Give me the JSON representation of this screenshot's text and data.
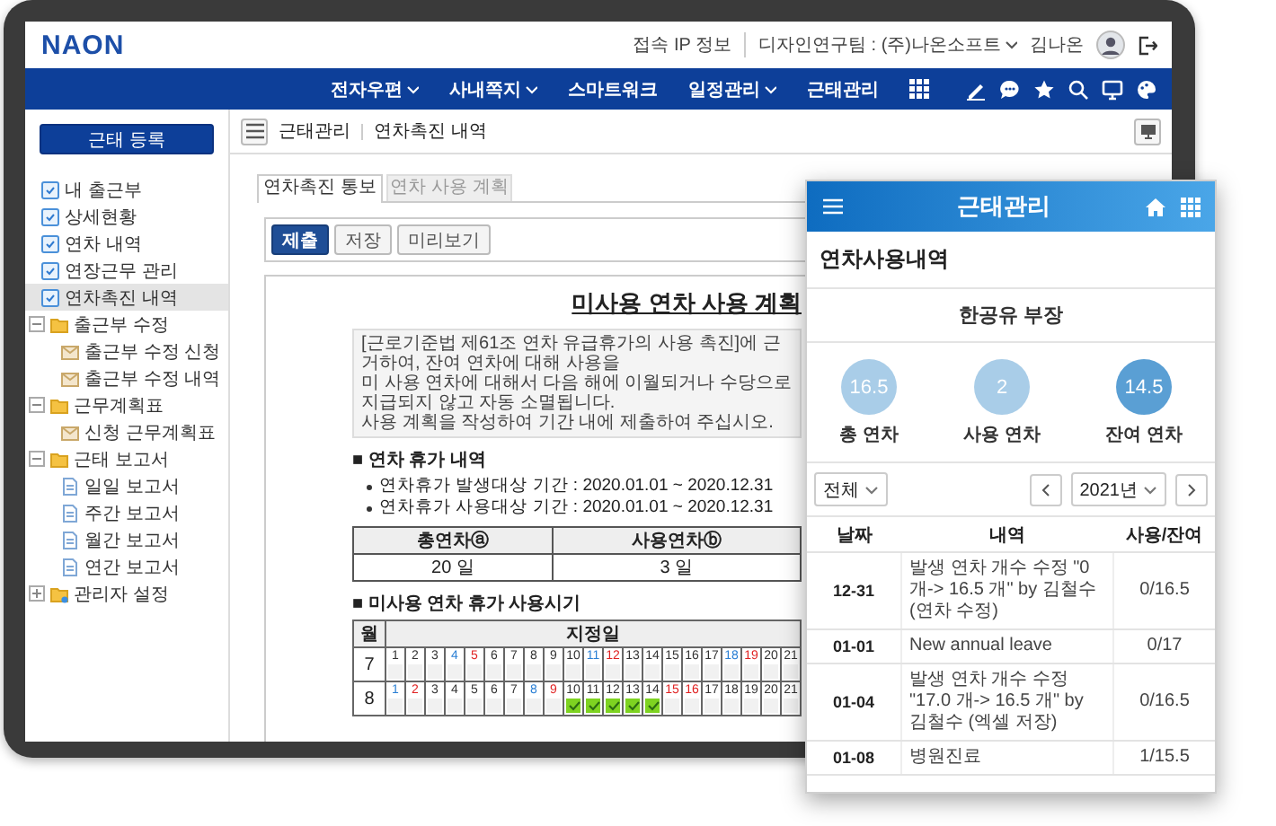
{
  "header": {
    "logo": "NAON",
    "ip_info": "접속 IP 정보",
    "team": "디자인연구팀 : (주)나온소프트",
    "team_dropdown": true,
    "user": "김나온"
  },
  "nav": {
    "items": [
      {
        "label": "전자우편",
        "dropdown": true
      },
      {
        "label": "사내쪽지",
        "dropdown": true
      },
      {
        "label": "스마트워크",
        "dropdown": false
      },
      {
        "label": "일정관리",
        "dropdown": true
      },
      {
        "label": "근태관리",
        "dropdown": false
      }
    ]
  },
  "sidebar": {
    "button": "근태 등록",
    "items": [
      {
        "label": "내 출근부",
        "kind": "page",
        "selected": false
      },
      {
        "label": "상세현황",
        "kind": "page",
        "selected": false
      },
      {
        "label": "연차 내역",
        "kind": "page",
        "selected": false
      },
      {
        "label": "연장근무 관리",
        "kind": "page",
        "selected": false
      },
      {
        "label": "연차촉진 내역",
        "kind": "page",
        "selected": true
      },
      {
        "label": "출근부 수정",
        "kind": "folder",
        "selected": false,
        "expanded": true,
        "children": [
          {
            "label": "출근부 수정 신청",
            "kind": "form",
            "selected": false
          },
          {
            "label": "출근부 수정 내역",
            "kind": "form",
            "selected": false
          }
        ]
      },
      {
        "label": "근무계획표",
        "kind": "folder",
        "selected": false,
        "expanded": true,
        "children": [
          {
            "label": "신청 근무계획표",
            "kind": "form",
            "selected": false
          }
        ]
      },
      {
        "label": "근태 보고서",
        "kind": "folder",
        "selected": false,
        "expanded": true,
        "children": [
          {
            "label": "일일 보고서",
            "kind": "report",
            "selected": false
          },
          {
            "label": "주간 보고서",
            "kind": "report",
            "selected": false
          },
          {
            "label": "월간 보고서",
            "kind": "report",
            "selected": false
          },
          {
            "label": "연간 보고서",
            "kind": "report",
            "selected": false
          }
        ]
      },
      {
        "label": "관리자 설정",
        "kind": "admin",
        "selected": false,
        "expanded": false
      }
    ]
  },
  "main": {
    "breadcrumb": [
      "근태관리",
      "연차촉진 내역"
    ],
    "tabs": [
      {
        "label": "연차촉진 통보",
        "selected": true
      },
      {
        "label": "연차 사용 계획",
        "selected": false
      }
    ],
    "toolbar": [
      {
        "label": "제출",
        "primary": true
      },
      {
        "label": "저장",
        "primary": false
      },
      {
        "label": "미리보기",
        "primary": false
      }
    ],
    "document": {
      "title": "미사용 연차 사용 계획",
      "notice": [
        "[근로기준법 제61조 연차 유급휴가의 사용 촉진]에 근거하여, 잔여 연차에 대해 사용을",
        "미 사용 연차에 대해서 다음 해에 이월되거나 수당으로 지급되지 않고 자동 소멸됩니다.",
        "사용 계획을 작성하여 기간 내에 제출하여 주십시오."
      ],
      "sections": [
        {
          "heading": "■ 연차 휴가 내역",
          "bullets": [
            "연차휴가 발생대상 기간 : 2020.01.01 ~ 2020.12.31",
            "연차휴가 사용대상 기간 : 2020.01.01 ~ 2020.12.31"
          ],
          "summary": {
            "columns": [
              "총연차ⓐ",
              "사용연차ⓑ"
            ],
            "values": [
              "20 일",
              "3 일"
            ]
          }
        },
        {
          "heading": "■ 미사용 연차 휴가 사용시기",
          "calendar": {
            "month_header": "월",
            "days_header": "지정일",
            "rows": [
              {
                "month": "7",
                "days": [
                  {
                    "d": "1",
                    "kind": "weekday",
                    "checked": false
                  },
                  {
                    "d": "2",
                    "kind": "weekday",
                    "checked": false
                  },
                  {
                    "d": "3",
                    "kind": "weekday",
                    "checked": false
                  },
                  {
                    "d": "4",
                    "kind": "saturday",
                    "checked": false
                  },
                  {
                    "d": "5",
                    "kind": "sunday",
                    "checked": false
                  },
                  {
                    "d": "6",
                    "kind": "weekday",
                    "checked": false
                  },
                  {
                    "d": "7",
                    "kind": "weekday",
                    "checked": false
                  },
                  {
                    "d": "8",
                    "kind": "weekday",
                    "checked": false
                  },
                  {
                    "d": "9",
                    "kind": "weekday",
                    "checked": false
                  },
                  {
                    "d": "10",
                    "kind": "weekday",
                    "checked": false
                  },
                  {
                    "d": "11",
                    "kind": "saturday",
                    "checked": false
                  },
                  {
                    "d": "12",
                    "kind": "sunday",
                    "checked": false
                  },
                  {
                    "d": "13",
                    "kind": "weekday",
                    "checked": false
                  },
                  {
                    "d": "14",
                    "kind": "weekday",
                    "checked": false
                  },
                  {
                    "d": "15",
                    "kind": "weekday",
                    "checked": false
                  },
                  {
                    "d": "16",
                    "kind": "weekday",
                    "checked": false
                  },
                  {
                    "d": "17",
                    "kind": "weekday",
                    "checked": false
                  },
                  {
                    "d": "18",
                    "kind": "saturday",
                    "checked": false
                  },
                  {
                    "d": "19",
                    "kind": "sunday",
                    "checked": false
                  },
                  {
                    "d": "20",
                    "kind": "weekday",
                    "checked": false
                  },
                  {
                    "d": "21",
                    "kind": "weekday",
                    "checked": false
                  }
                ]
              },
              {
                "month": "8",
                "days": [
                  {
                    "d": "1",
                    "kind": "saturday",
                    "checked": false
                  },
                  {
                    "d": "2",
                    "kind": "sunday",
                    "checked": false
                  },
                  {
                    "d": "3",
                    "kind": "weekday",
                    "checked": false
                  },
                  {
                    "d": "4",
                    "kind": "weekday",
                    "checked": false
                  },
                  {
                    "d": "5",
                    "kind": "weekday",
                    "checked": false
                  },
                  {
                    "d": "6",
                    "kind": "weekday",
                    "checked": false
                  },
                  {
                    "d": "7",
                    "kind": "weekday",
                    "checked": false
                  },
                  {
                    "d": "8",
                    "kind": "saturday",
                    "checked": false
                  },
                  {
                    "d": "9",
                    "kind": "sunday",
                    "checked": false
                  },
                  {
                    "d": "10",
                    "kind": "weekday",
                    "checked": true
                  },
                  {
                    "d": "11",
                    "kind": "weekday",
                    "checked": true
                  },
                  {
                    "d": "12",
                    "kind": "weekday",
                    "checked": true
                  },
                  {
                    "d": "13",
                    "kind": "weekday",
                    "checked": true
                  },
                  {
                    "d": "14",
                    "kind": "weekday",
                    "checked": true
                  },
                  {
                    "d": "15",
                    "kind": "holiday",
                    "checked": false
                  },
                  {
                    "d": "16",
                    "kind": "sunday",
                    "checked": false
                  },
                  {
                    "d": "17",
                    "kind": "weekday",
                    "checked": false
                  },
                  {
                    "d": "18",
                    "kind": "weekday",
                    "checked": false
                  },
                  {
                    "d": "19",
                    "kind": "weekday",
                    "checked": false
                  },
                  {
                    "d": "20",
                    "kind": "weekday",
                    "checked": false
                  },
                  {
                    "d": "21",
                    "kind": "weekday",
                    "checked": false
                  }
                ]
              }
            ]
          }
        }
      ]
    }
  },
  "mobile": {
    "title": "근태관리",
    "page_title": "연차사용내역",
    "person": "한공유 부장",
    "stats": [
      {
        "value": "16.5",
        "label": "총 연차",
        "highlighted": false
      },
      {
        "value": "2",
        "label": "사용 연차",
        "highlighted": false
      },
      {
        "value": "14.5",
        "label": "잔여 연차",
        "highlighted": true
      }
    ],
    "filter": "전체",
    "year": "2021년",
    "table": {
      "columns": [
        "날짜",
        "내역",
        "사용/잔여"
      ],
      "rows": [
        [
          "12-31",
          "발생 연차 개수 수정 \"0 개-> 16.5 개\" by 김철수 (연차 수정)",
          "0/16.5"
        ],
        [
          "01-01",
          "New annual leave",
          "0/17"
        ],
        [
          "01-04",
          "발생 연차 개수 수정 \"17.0 개-> 16.5 개\" by 김철수 (엑셀 저장)",
          "0/16.5"
        ],
        [
          "01-08",
          "병원진료",
          "1/15.5"
        ]
      ]
    }
  }
}
